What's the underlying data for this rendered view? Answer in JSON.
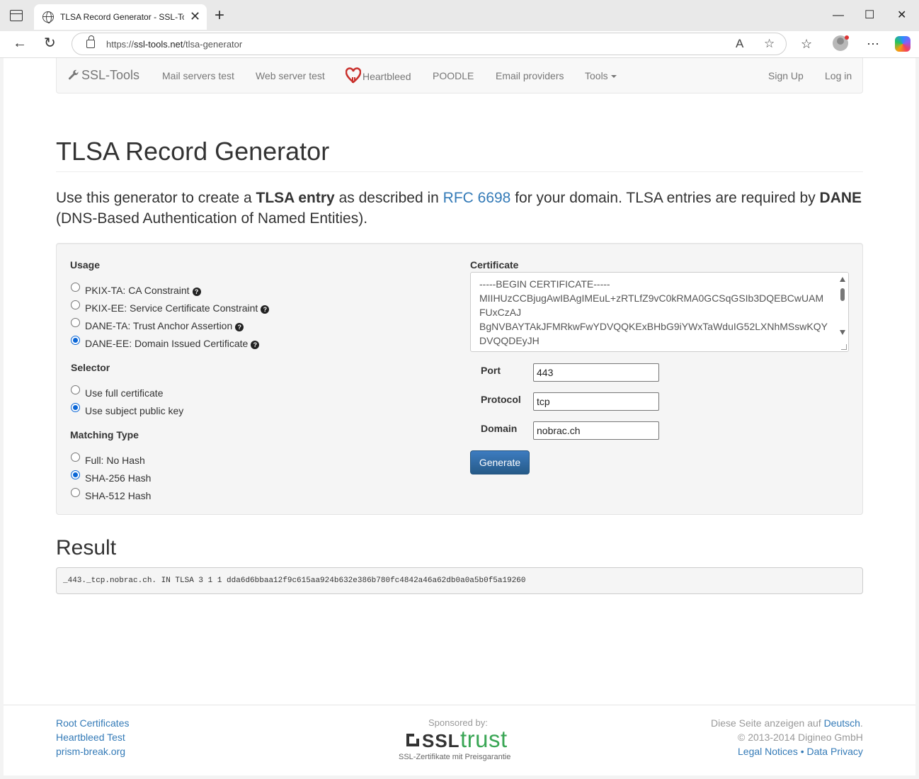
{
  "browser": {
    "tab_title": "TLSA Record Generator - SSL-Tools",
    "tab_close": "✕",
    "new_tab": "+",
    "url_prefix": "https://",
    "url_host": "ssl-tools.net",
    "url_path": "/tlsa-generator",
    "minimize": "—",
    "maximize": "☐",
    "close": "✕"
  },
  "navbar": {
    "brand": "SSL-Tools",
    "items": [
      {
        "label": "Mail servers test"
      },
      {
        "label": "Web server test"
      },
      {
        "label": "Heartbleed"
      },
      {
        "label": "POODLE"
      },
      {
        "label": "Email providers"
      },
      {
        "label": "Tools"
      }
    ],
    "signup": "Sign Up",
    "login": "Log in"
  },
  "page": {
    "title": "TLSA Record Generator",
    "lead_1": "Use this generator to create a ",
    "lead_bold_1": "TLSA entry",
    "lead_2": " as described in ",
    "lead_link": "RFC 6698",
    "lead_3": " for your domain. TLSA entries are required by ",
    "lead_bold_2": "DANE",
    "lead_4": " (DNS-Based Authentication of Named Entities)."
  },
  "form": {
    "usage_label": "Usage",
    "usage_options": [
      {
        "label": "PKIX-TA: CA Constraint",
        "checked": false
      },
      {
        "label": "PKIX-EE: Service Certificate Constraint",
        "checked": false
      },
      {
        "label": "DANE-TA: Trust Anchor Assertion",
        "checked": false
      },
      {
        "label": "DANE-EE: Domain Issued Certificate",
        "checked": true
      }
    ],
    "selector_label": "Selector",
    "selector_options": [
      {
        "label": "Use full certificate",
        "checked": false
      },
      {
        "label": "Use subject public key",
        "checked": true
      }
    ],
    "matching_label": "Matching Type",
    "matching_options": [
      {
        "label": "Full: No Hash",
        "checked": false
      },
      {
        "label": "SHA-256 Hash",
        "checked": true
      },
      {
        "label": "SHA-512 Hash",
        "checked": false
      }
    ],
    "certificate_label": "Certificate",
    "certificate_lines": [
      "-----BEGIN CERTIFICATE-----",
      "MIIHUzCCBjugAwIBAgIMEuL+zRTLfZ9vC0kRMA0GCSqGSIb3DQEBCwUAM",
      "FUxCzAJ",
      "BgNVBAYTAkJFMRkwFwYDVQQKExBHbG9iYWxTaWduIG52LXNhMSswKQY",
      "DVQQDEyJH"
    ],
    "port_label": "Port",
    "port_value": "443",
    "protocol_label": "Protocol",
    "protocol_value": "tcp",
    "domain_label": "Domain",
    "domain_value": "nobrac.ch",
    "generate": "Generate",
    "help_glyph": "?"
  },
  "result": {
    "title": "Result",
    "value": "_443._tcp.nobrac.ch. IN TLSA 3 1 1 dda6d6bbaa12f9c615aa924b632e386b780fc4842a46a62db0a0a5b0f5a19260"
  },
  "footer": {
    "links_left": [
      "Root Certificates",
      "Heartbleed Test",
      "prism-break.org"
    ],
    "sponsored": "Sponsored by:",
    "logo_ssl": "SSL",
    "logo_trust": "trust",
    "logo_sub": "SSL-Zertifikate mit Preisgarantie",
    "lang_text": "Diese Seite anzeigen auf ",
    "lang_link": "Deutsch",
    "lang_dot": ".",
    "copyright": "© 2013-2014 Digineo GmbH",
    "legal": "Legal Notices",
    "sep": " • ",
    "privacy": "Data Privacy"
  },
  "colors": {
    "link": "#337ab7",
    "primary_button": "#265a88",
    "heart": "#c9302c",
    "sponsor_green": "#3aa655"
  }
}
